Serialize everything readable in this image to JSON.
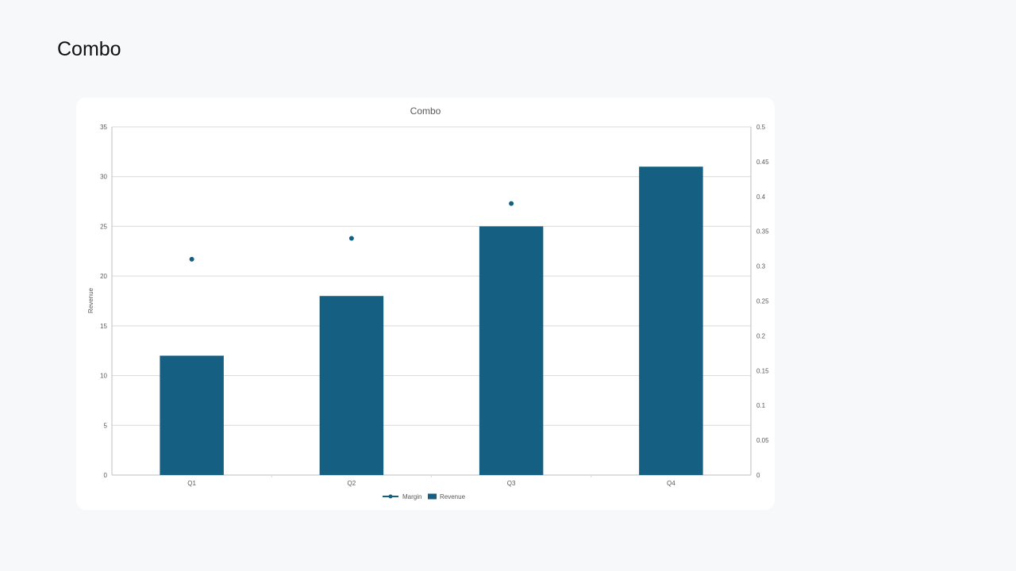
{
  "page": {
    "title": "Combo"
  },
  "chart_data": {
    "type": "bar",
    "title": "Combo",
    "categories": [
      "Q1",
      "Q2",
      "Q3",
      "Q4"
    ],
    "series": [
      {
        "name": "Revenue",
        "type": "bar",
        "axis": "left",
        "values": [
          12,
          18,
          25,
          31
        ]
      },
      {
        "name": "Margin",
        "type": "line",
        "axis": "right",
        "values": [
          0.31,
          0.34,
          0.39,
          null
        ]
      }
    ],
    "ylabel": "Revenue",
    "y2label": "",
    "ylim": [
      0,
      35
    ],
    "y2lim": [
      0,
      0.5
    ],
    "yticks": [
      0,
      5,
      10,
      15,
      20,
      25,
      30,
      35
    ],
    "y2ticks": [
      0,
      0.05,
      0.1,
      0.15,
      0.2,
      0.25,
      0.3,
      0.35,
      0.4,
      0.45,
      0.5
    ],
    "legend_order": [
      "Margin",
      "Revenue"
    ],
    "legend_position": "bottom",
    "grid": true,
    "colors": {
      "bar": "#156082",
      "line": "#156082",
      "grid": "#d9d9d9",
      "axis": "#bfbfbf",
      "tick_text": "#595959"
    }
  }
}
